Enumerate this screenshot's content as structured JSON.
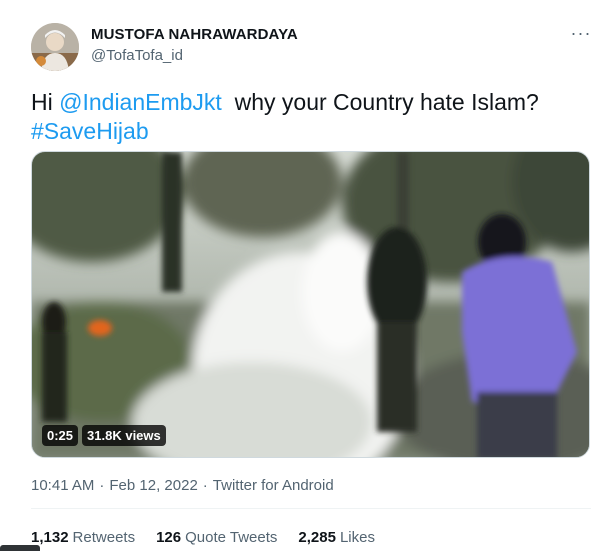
{
  "author": {
    "display_name": "MUSTOFA NAHRAWARDAYA",
    "handle": "@TofaTofa_id",
    "avatar_icon": "user-avatar-photo"
  },
  "more_icon": "more-options-icon",
  "tweet": {
    "prefix": "Hi ",
    "mention": "@IndianEmbJkt",
    "body": "  why your Country hate Islam?",
    "hashtag": "#SaveHijab"
  },
  "video": {
    "duration": "0:25",
    "views": "31.8K views"
  },
  "meta": {
    "time": "10:41 AM",
    "separator": "·",
    "date": "Feb 12, 2022",
    "source": "Twitter for Android"
  },
  "stats": [
    {
      "count": "1,132",
      "label": "Retweets"
    },
    {
      "count": "126",
      "label": "Quote Tweets"
    },
    {
      "count": "2,285",
      "label": "Likes"
    }
  ],
  "colors": {
    "link": "#1d9bf0",
    "secondary_text": "#536471",
    "primary_text": "#0f1419"
  }
}
